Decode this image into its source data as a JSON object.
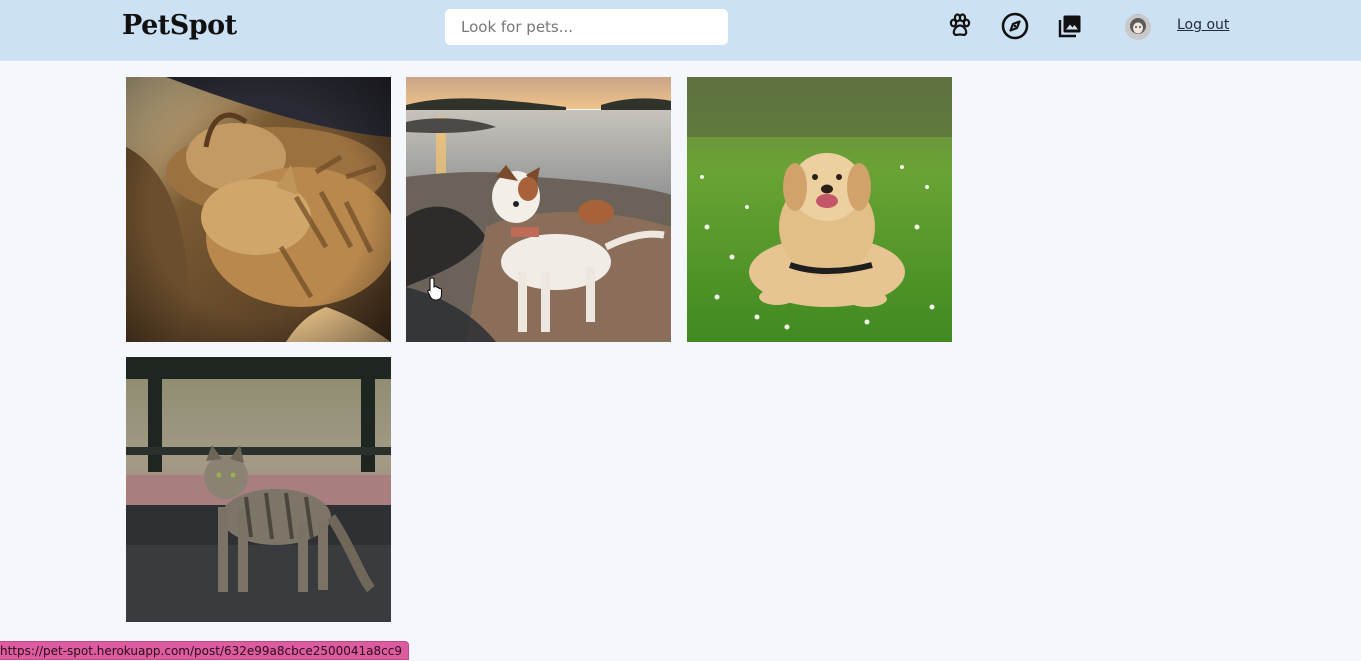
{
  "app": {
    "logo": "PetSpot"
  },
  "header": {
    "search_placeholder": "Look for pets...",
    "search_value": "",
    "icons": [
      "paw-icon",
      "compass-icon",
      "gallery-icon"
    ],
    "logout_label": "Log out"
  },
  "gallery": {
    "posts": [
      {
        "subject": "two-tabby-kittens-sleeping"
      },
      {
        "subject": "jack-russell-terrier-on-rocks-at-sunset"
      },
      {
        "subject": "golden-retriever-in-grass"
      },
      {
        "subject": "tabby-cat-on-street"
      }
    ]
  },
  "status_bar": {
    "url": "https://pet-spot.herokuapp.com/post/632e99a8cbce2500041a8cc9"
  },
  "colors": {
    "navbar_bg": "#cde1f4",
    "page_bg": "#f4f8fc",
    "status_bg": "#dd5c9f"
  }
}
